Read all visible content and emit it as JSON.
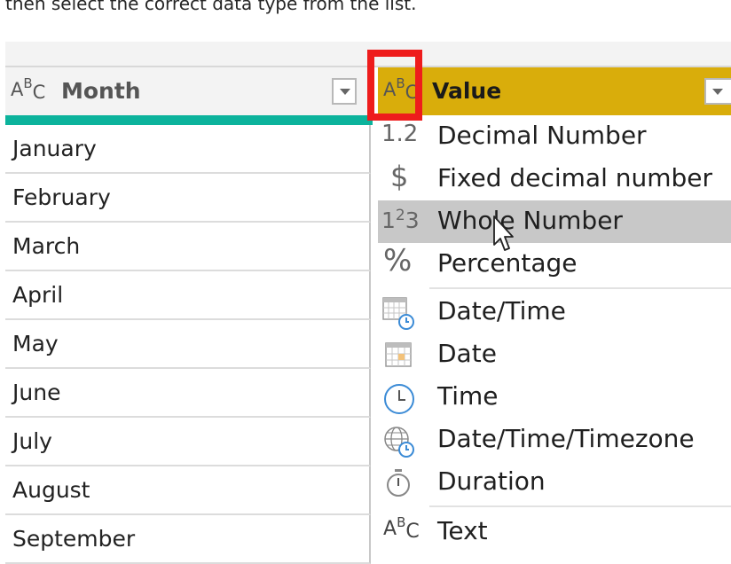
{
  "intro_text": "then select the correct data type from the list.",
  "month_column": {
    "header_label": "Month",
    "type_icon": "abc-text-icon",
    "rows": [
      "January",
      "February",
      "March",
      "April",
      "May",
      "June",
      "July",
      "August",
      "September"
    ]
  },
  "value_column": {
    "header_label": "Value",
    "type_icon": "abc-text-icon",
    "header_color": "#d9ad0b"
  },
  "data_types": [
    {
      "label": "Decimal Number",
      "icon": "decimal-icon",
      "glyph": "1.2"
    },
    {
      "label": "Fixed decimal number",
      "icon": "dollar-icon",
      "glyph": "$"
    },
    {
      "label": "Whole Number",
      "icon": "whole-number-icon",
      "glyph": "123"
    },
    {
      "label": "Percentage",
      "icon": "percent-icon",
      "glyph": "%"
    },
    {
      "label": "Date/Time",
      "icon": "datetime-icon",
      "glyph": ""
    },
    {
      "label": "Date",
      "icon": "calendar-icon",
      "glyph": ""
    },
    {
      "label": "Time",
      "icon": "clock-icon",
      "glyph": ""
    },
    {
      "label": "Date/Time/Timezone",
      "icon": "globe-clock-icon",
      "glyph": ""
    },
    {
      "label": "Duration",
      "icon": "stopwatch-icon",
      "glyph": ""
    },
    {
      "label": "Text",
      "icon": "abc-text-icon",
      "glyph": "ABC"
    }
  ],
  "selected_type": "Whole Number",
  "abc_glyph": {
    "a": "A",
    "b": "B",
    "c": "C"
  },
  "colors": {
    "teal": "#0cb39c",
    "highlight": "#ee1c1c",
    "selected_row": "#c8c8c8"
  }
}
